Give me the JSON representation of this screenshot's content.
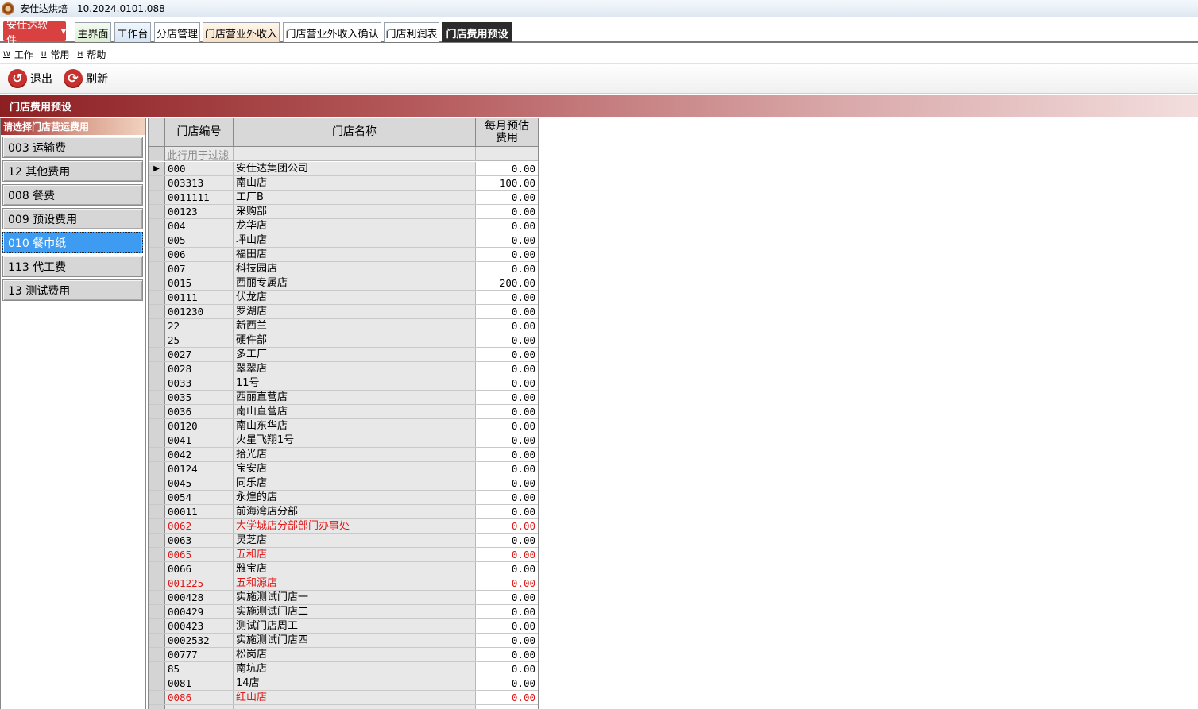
{
  "window": {
    "title": "安仕达烘焙",
    "version": "10.2024.0101.088"
  },
  "brand_button": "安仕达软件",
  "tabs": [
    {
      "label": "主界面",
      "style": "green"
    },
    {
      "label": "工作台",
      "style": "blue"
    },
    {
      "label": "分店管理",
      "style": "plain"
    },
    {
      "label": "门店营业外收入",
      "style": "orange"
    },
    {
      "label": "门店营业外收入确认",
      "style": "plain"
    },
    {
      "label": "门店利润表",
      "style": "plain"
    },
    {
      "label": "门店费用预设",
      "style": "active"
    }
  ],
  "menu": [
    {
      "key": "W",
      "label": "工作"
    },
    {
      "key": "U",
      "label": "常用"
    },
    {
      "key": "H",
      "label": "帮助"
    }
  ],
  "toolbar": {
    "exit_label": "退出",
    "refresh_label": "刷新"
  },
  "section_title": "门店费用预设",
  "left_panel": {
    "title": "请选择门店营运费用",
    "items": [
      {
        "label": "003  运输费"
      },
      {
        "label": "12  其他费用"
      },
      {
        "label": "008  餐费"
      },
      {
        "label": "009  预设费用"
      },
      {
        "label": "010  餐巾纸",
        "selected": true
      },
      {
        "label": "113  代工费"
      },
      {
        "label": "13  测试费用"
      }
    ]
  },
  "grid": {
    "headers": {
      "code": "门店编号",
      "name": "门店名称",
      "fee": "每月预估费用"
    },
    "filter_placeholder": "此行用于过滤",
    "rows": [
      {
        "code": "000",
        "name": "安仕达集团公司",
        "fee": "0.00",
        "current": true
      },
      {
        "code": "003313",
        "name": "南山店",
        "fee": "100.00"
      },
      {
        "code": "0011111",
        "name": "工厂B",
        "fee": "0.00"
      },
      {
        "code": "00123",
        "name": "采购部",
        "fee": "0.00"
      },
      {
        "code": "004",
        "name": "龙华店",
        "fee": "0.00"
      },
      {
        "code": "005",
        "name": "坪山店",
        "fee": "0.00"
      },
      {
        "code": "006",
        "name": "福田店",
        "fee": "0.00"
      },
      {
        "code": "007",
        "name": "科技园店",
        "fee": "0.00"
      },
      {
        "code": "0015",
        "name": "西丽专属店",
        "fee": "200.00"
      },
      {
        "code": "00111",
        "name": "伏龙店",
        "fee": "0.00"
      },
      {
        "code": "001230",
        "name": "罗湖店",
        "fee": "0.00"
      },
      {
        "code": "22",
        "name": "新西兰",
        "fee": "0.00"
      },
      {
        "code": "25",
        "name": "硬件部",
        "fee": "0.00"
      },
      {
        "code": "0027",
        "name": "多工厂",
        "fee": "0.00"
      },
      {
        "code": "0028",
        "name": "翠翠店",
        "fee": "0.00"
      },
      {
        "code": "0033",
        "name": "11号",
        "fee": "0.00"
      },
      {
        "code": "0035",
        "name": "西丽直营店",
        "fee": "0.00"
      },
      {
        "code": "0036",
        "name": "南山直营店",
        "fee": "0.00"
      },
      {
        "code": "00120",
        "name": "南山东华店",
        "fee": "0.00"
      },
      {
        "code": "0041",
        "name": "火星飞翔1号",
        "fee": "0.00"
      },
      {
        "code": "0042",
        "name": "拾光店",
        "fee": "0.00"
      },
      {
        "code": "00124",
        "name": "宝安店",
        "fee": "0.00"
      },
      {
        "code": "0045",
        "name": "同乐店",
        "fee": "0.00"
      },
      {
        "code": "0054",
        "name": "永煌的店",
        "fee": "0.00"
      },
      {
        "code": "00011",
        "name": "前海湾店分部",
        "fee": "0.00"
      },
      {
        "code": "0062",
        "name": "大学城店分部部门办事处",
        "fee": "0.00",
        "red": true
      },
      {
        "code": "0063",
        "name": "灵芝店",
        "fee": "0.00"
      },
      {
        "code": "0065",
        "name": "五和店",
        "fee": "0.00",
        "red": true
      },
      {
        "code": "0066",
        "name": "雅宝店",
        "fee": "0.00"
      },
      {
        "code": "001225",
        "name": "五和源店",
        "fee": "0.00",
        "red": true
      },
      {
        "code": "000428",
        "name": "实施测试门店一",
        "fee": "0.00"
      },
      {
        "code": "000429",
        "name": "实施测试门店二",
        "fee": "0.00"
      },
      {
        "code": "000423",
        "name": "测试门店周工",
        "fee": "0.00"
      },
      {
        "code": "0002532",
        "name": "实施测试门店四",
        "fee": "0.00"
      },
      {
        "code": "00777",
        "name": "松岗店",
        "fee": "0.00"
      },
      {
        "code": "85",
        "name": "南坑店",
        "fee": "0.00"
      },
      {
        "code": "0081",
        "name": "14店",
        "fee": "0.00"
      },
      {
        "code": "0086",
        "name": "红山店",
        "fee": "0.00",
        "red": true
      },
      {
        "code": "",
        "name": "",
        "fee": ""
      }
    ]
  }
}
